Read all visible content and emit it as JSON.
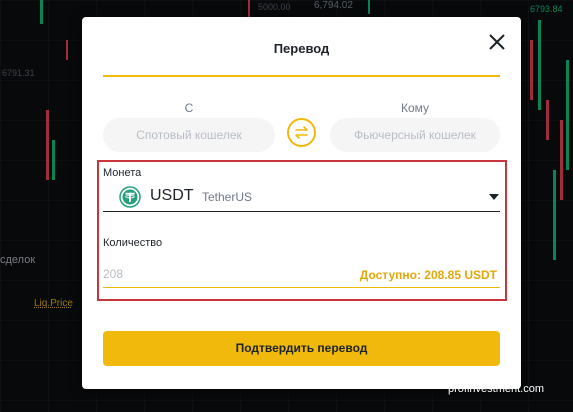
{
  "background": {
    "prices": [
      "5000.00",
      "6,794.02",
      "6793.84",
      "6791.31"
    ],
    "orderbook_text": "сделок",
    "liq_price_label": "Liq.Price"
  },
  "modal": {
    "title": "Перевод",
    "close_icon": "close-icon",
    "from_label": "С",
    "to_label": "Кому",
    "from_wallet": "Спотовый кошелек",
    "to_wallet": "Фьючерсный кошелек",
    "swap_icon": "swap-arrows-icon",
    "coin_label": "Монета",
    "coin": {
      "symbol": "USDT",
      "name": "TetherUS",
      "icon": "tether-icon"
    },
    "amount_label": "Количество",
    "amount_value": "208",
    "available_text": "Доступно: 208.85 USDT",
    "confirm_button": "Подтвердить перевод"
  },
  "watermark": "profinvestment.com",
  "colors": {
    "accent": "#f0b90b",
    "highlight": "#c8363c",
    "tether": "#26a17b"
  }
}
